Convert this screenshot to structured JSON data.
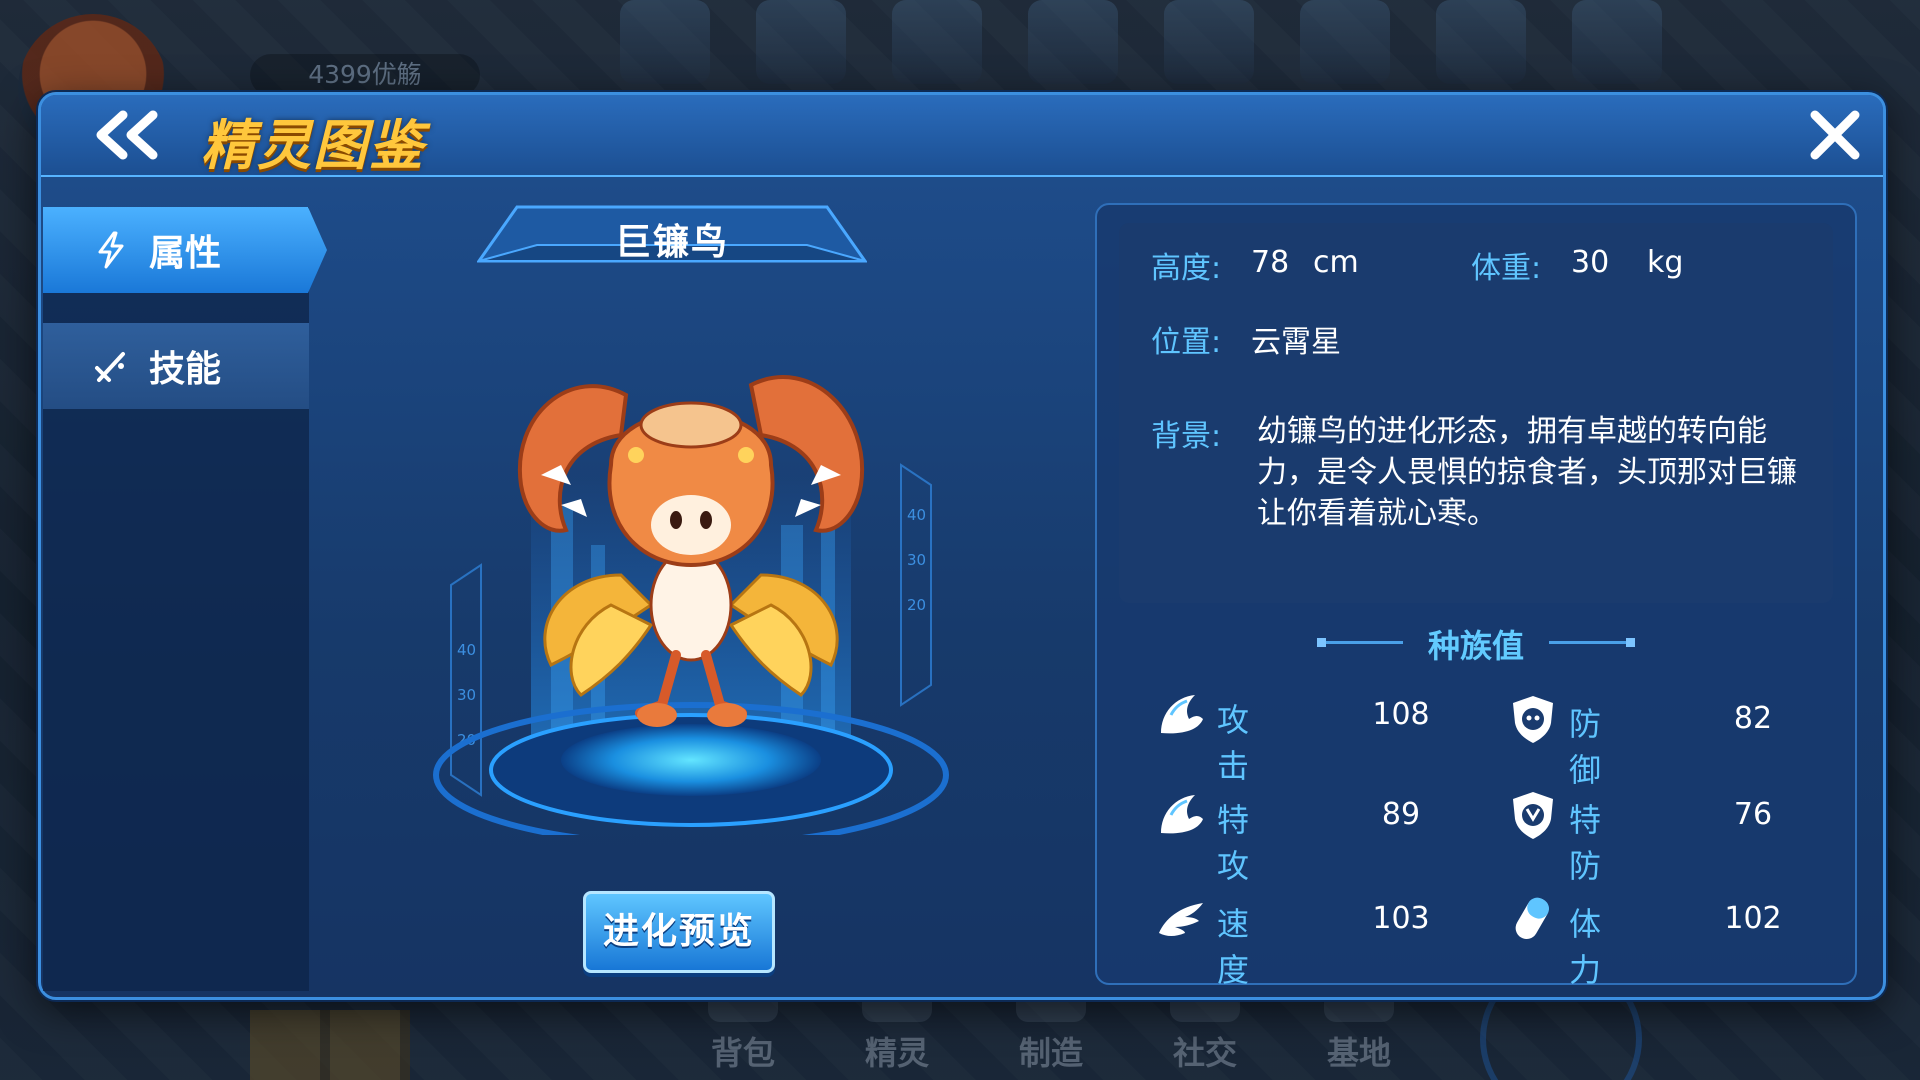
{
  "background": {
    "username": "4399优觞",
    "bottom_nav": [
      "背包",
      "精灵",
      "制造",
      "社交",
      "基地"
    ]
  },
  "dialog": {
    "title": "精灵图鉴",
    "tabs": [
      {
        "label": "属性",
        "icon": "lightning-icon",
        "active": true
      },
      {
        "label": "技能",
        "icon": "sword-icon",
        "active": false
      }
    ]
  },
  "creature": {
    "name": "巨镰鸟",
    "evolve_button": "进化预览"
  },
  "info": {
    "height_label": "高度:",
    "height_value": "78",
    "height_unit": "cm",
    "weight_label": "体重:",
    "weight_value": "30",
    "weight_unit": "kg",
    "location_label": "位置:",
    "location_value": "云霄星",
    "background_label": "背景:",
    "background_text": "幼镰鸟的进化形态，拥有卓越的转向能力，是令人畏惧的掠食者，头顶那对巨镰让你看着就心寒。"
  },
  "stats": {
    "title": "种族值",
    "items": [
      {
        "label": "攻击",
        "value": "108",
        "icon": "claw-icon"
      },
      {
        "label": "防御",
        "value": "82",
        "icon": "shield-icon"
      },
      {
        "label": "特攻",
        "value": "89",
        "icon": "claw-icon"
      },
      {
        "label": "特防",
        "value": "76",
        "icon": "shield-icon"
      },
      {
        "label": "速度",
        "value": "103",
        "icon": "wing-icon"
      },
      {
        "label": "体力",
        "value": "102",
        "icon": "capsule-icon"
      }
    ]
  },
  "colors": {
    "title_gold": "#ffc73c",
    "accent_blue": "#5fc5ff",
    "panel_blue": "#1a3b6e"
  }
}
